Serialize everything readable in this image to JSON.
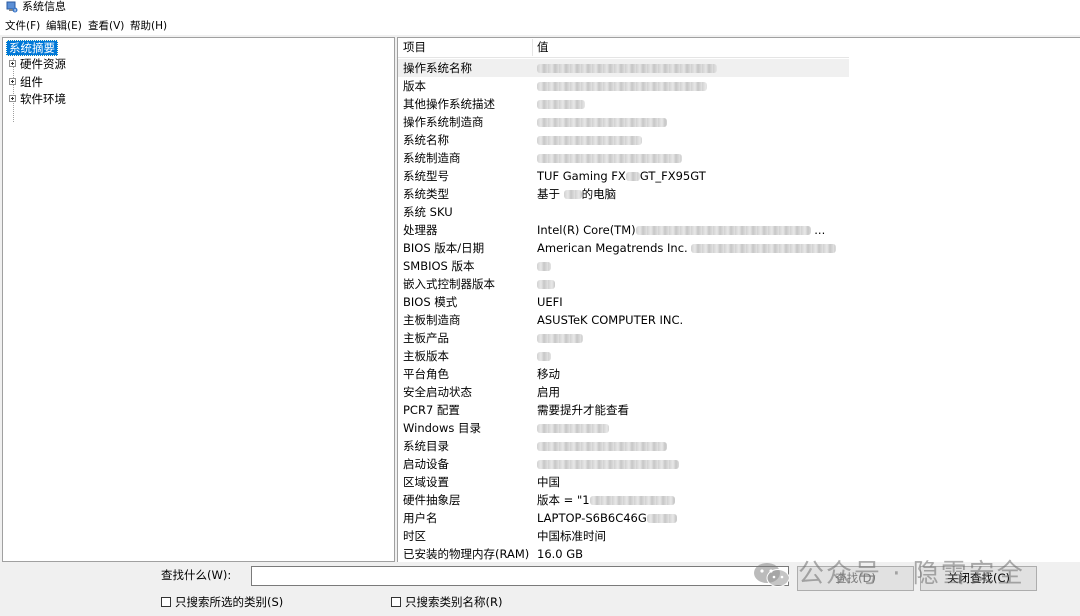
{
  "window": {
    "title": "系统信息",
    "icon": "system-info-icon"
  },
  "menu": [
    {
      "label": "文件(F)"
    },
    {
      "label": "编辑(E)"
    },
    {
      "label": "查看(V)"
    },
    {
      "label": "帮助(H)"
    }
  ],
  "tree": {
    "root": "系统摘要",
    "children": [
      {
        "label": "硬件资源"
      },
      {
        "label": "组件"
      },
      {
        "label": "软件环境"
      }
    ]
  },
  "table": {
    "columns": {
      "item": "项目",
      "value": "值"
    },
    "rows": [
      {
        "item": "操作系统名称",
        "value": ""
      },
      {
        "item": "版本",
        "value": ""
      },
      {
        "item": "其他操作系统描述",
        "value": ""
      },
      {
        "item": "操作系统制造商",
        "value": ""
      },
      {
        "item": "系统名称",
        "value": ""
      },
      {
        "item": "系统制造商",
        "value": ""
      },
      {
        "item": "系统型号",
        "value": "TUF Gaming FX",
        "suffix": "GT_FX95GT"
      },
      {
        "item": "系统类型",
        "value": "基于",
        "suffix": "的电脑"
      },
      {
        "item": "系统 SKU",
        "value": ""
      },
      {
        "item": "处理器",
        "value": "Intel(R) Core(TM)",
        "suffix": "..."
      },
      {
        "item": "BIOS 版本/日期",
        "value": "American Megatrends Inc."
      },
      {
        "item": "SMBIOS 版本",
        "value": ""
      },
      {
        "item": "嵌入式控制器版本",
        "value": ""
      },
      {
        "item": "BIOS 模式",
        "value": "UEFI"
      },
      {
        "item": "主板制造商",
        "value": "ASUSTeK COMPUTER INC."
      },
      {
        "item": "主板产品",
        "value": ""
      },
      {
        "item": "主板版本",
        "value": ""
      },
      {
        "item": "平台角色",
        "value": "移动"
      },
      {
        "item": "安全启动状态",
        "value": "启用"
      },
      {
        "item": "PCR7 配置",
        "value": "需要提升才能查看"
      },
      {
        "item": "Windows 目录",
        "value": ""
      },
      {
        "item": "系统目录",
        "value": ""
      },
      {
        "item": "启动设备",
        "value": ""
      },
      {
        "item": "区域设置",
        "value": "中国"
      },
      {
        "item": "硬件抽象层",
        "value": "版本 = \"1"
      },
      {
        "item": "用户名",
        "value": "LAPTOP-S6B6C46G"
      },
      {
        "item": "时区",
        "value": "中国标准时间"
      },
      {
        "item": "已安装的物理内存(RAM)",
        "value": "16.0 GB"
      }
    ]
  },
  "find": {
    "label": "查找什么(W):",
    "input_value": "",
    "find_button": "查找(D)",
    "close_find_button": "关闭查找(C)",
    "only_selected_category": "只搜索所选的类别(S)",
    "only_category_names": "只搜索类别名称(R)"
  },
  "watermark": {
    "text": "公众号 · 隐雪安全",
    "icon": "wechat-icon"
  }
}
